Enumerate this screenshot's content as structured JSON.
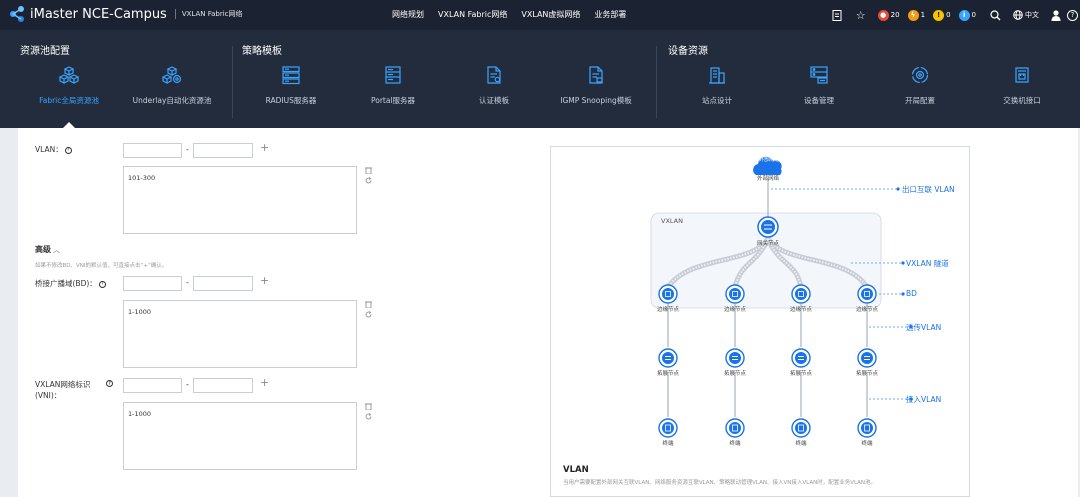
{
  "header": {
    "brand": "iMaster",
    "product": "NCE-Campus",
    "subtitle": "VXLAN Fabric网络",
    "nav": [
      "网络规划",
      "VXLAN Fabric网络",
      "VXLAN虚拟网络",
      "业务部署"
    ],
    "alerts": {
      "critical": "20",
      "major": "1",
      "minor": "0",
      "info": "0"
    },
    "language": "中文",
    "colors": {
      "critical": "#e8493c",
      "major": "#f39c12",
      "minor": "#f5c400",
      "info": "#3aa3ff"
    }
  },
  "menu": {
    "sections": [
      "资源池配置",
      "策略模板",
      "设备资源"
    ],
    "items": [
      {
        "label": "Fabric全局资源池",
        "icon": "cubes-icon",
        "active": true
      },
      {
        "label": "Underlay自动化资源池",
        "icon": "cubes-gear-icon"
      },
      {
        "label": "RADIUS服务器",
        "icon": "server-stack-icon"
      },
      {
        "label": "Portal服务器",
        "icon": "server-rack-icon"
      },
      {
        "label": "认证模板",
        "icon": "document-auth-icon"
      },
      {
        "label": "IGMP Snooping模板",
        "icon": "document-igmp-icon"
      },
      {
        "label": "站点设计",
        "icon": "building-icon"
      },
      {
        "label": "设备管理",
        "icon": "device-manage-icon"
      },
      {
        "label": "开局配置",
        "icon": "gear-cycle-icon"
      },
      {
        "label": "交换机接口",
        "icon": "switch-port-icon"
      }
    ],
    "accent": "#3aa3ff"
  },
  "form": {
    "vlan": {
      "label": "VLAN：",
      "range_text": "101-300"
    },
    "advanced": {
      "label": "高级",
      "hint": "如果不修改BD、VNI的默认值，可直接点击“+”确认。"
    },
    "bd": {
      "label": "桥接广播域(BD)：",
      "range_text": "1-1000"
    },
    "vni": {
      "label_line1": "VXLAN网络标识",
      "label_line2": "(VNI)：",
      "range_text": "1-1000"
    },
    "dash": "-",
    "plus": "+"
  },
  "diagram": {
    "external_network": "外部网络",
    "external_icon_label": "外部网络",
    "vxlan_box": "VXLAN",
    "gateway_node": "网关节点",
    "edge_node": "边缘节点",
    "extend_node": "拓展节点",
    "terminal": "终端",
    "annotations": [
      "出口互联 VLAN",
      "VXLAN 隧道",
      "BD",
      "透传VLAN",
      "接入VLAN"
    ],
    "legend_title": "VLAN",
    "legend_desc": "当用户需要配置外部网关互联VLAN、网络服务资源互联VLAN、策略联动管理VLAN、接入VN接入VLAN时，配置业务VLAN池。"
  }
}
